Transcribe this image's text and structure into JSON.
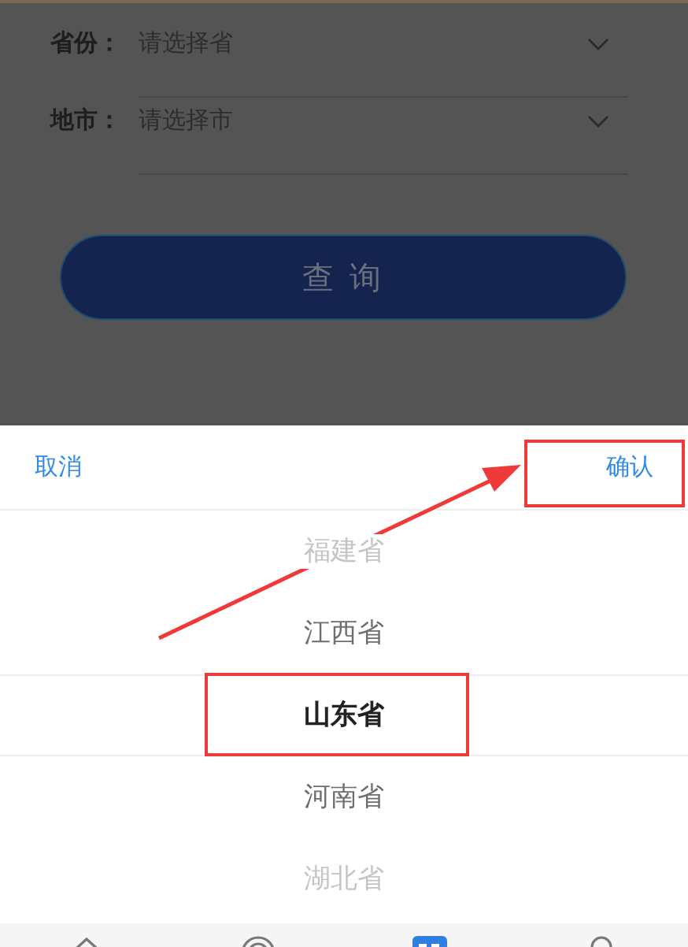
{
  "form": {
    "fields": [
      {
        "label": "省份：",
        "placeholder": "请选择省"
      },
      {
        "label": "地市：",
        "placeholder": "请选择市"
      }
    ],
    "submit": "查 询"
  },
  "picker": {
    "cancel": "取消",
    "confirm": "确认",
    "options": [
      {
        "label": "福建省",
        "selected": false
      },
      {
        "label": "江西省",
        "selected": false
      },
      {
        "label": "山东省",
        "selected": true
      },
      {
        "label": "河南省",
        "selected": false
      },
      {
        "label": "湖北省",
        "selected": false
      }
    ]
  },
  "tab_bar": {
    "items": [
      {
        "kind": "home",
        "selected": false
      },
      {
        "kind": "target",
        "selected": false
      },
      {
        "kind": "grid",
        "selected": true
      },
      {
        "kind": "person",
        "selected": false
      }
    ]
  }
}
